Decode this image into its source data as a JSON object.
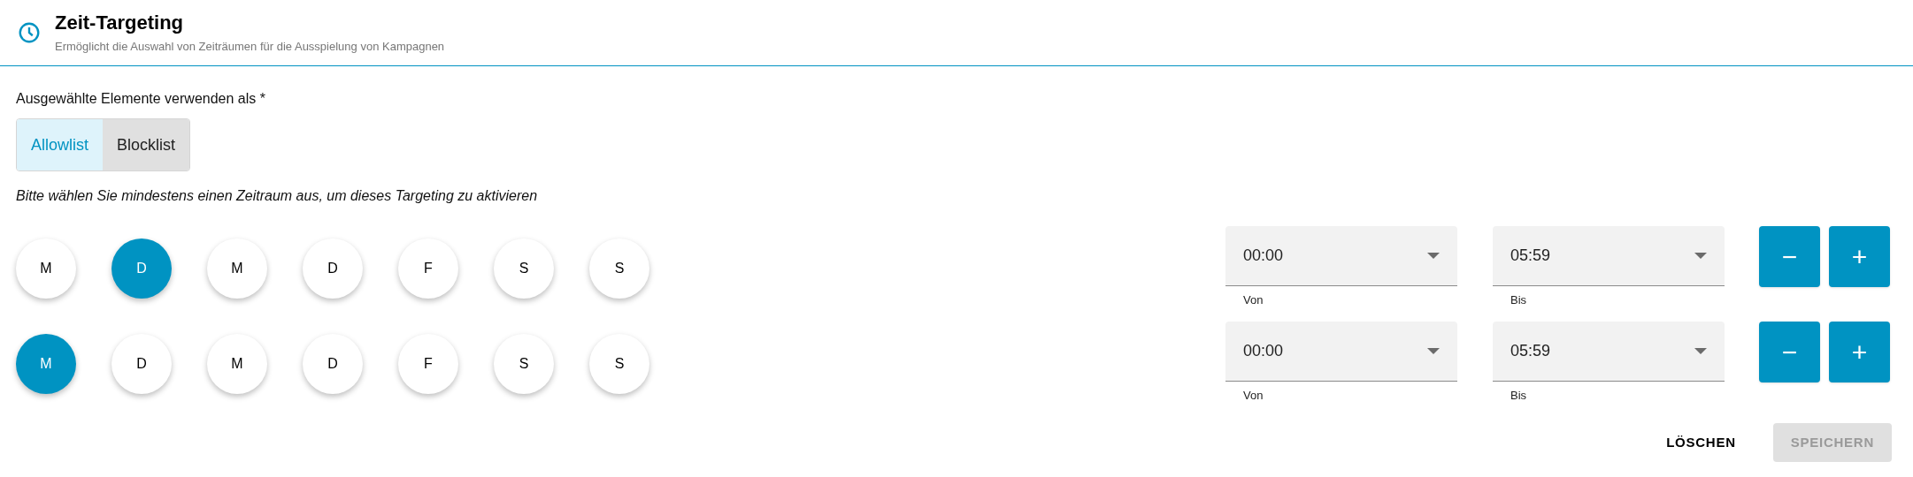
{
  "header": {
    "title": "Zeit-Targeting",
    "subtitle": "Ermöglicht die Auswahl von Zeiträumen für die Ausspielung von Kampagnen"
  },
  "mode": {
    "label": "Ausgewählte Elemente verwenden als *",
    "options": [
      {
        "label": "Allowlist",
        "selected": true
      },
      {
        "label": "Blocklist",
        "selected": false
      }
    ]
  },
  "hint": "Bitte wählen Sie mindestens einen Zeitraum aus, um dieses Targeting zu aktivieren",
  "periods": [
    {
      "days": [
        {
          "label": "M",
          "selected": false
        },
        {
          "label": "D",
          "selected": true
        },
        {
          "label": "M",
          "selected": false
        },
        {
          "label": "D",
          "selected": false
        },
        {
          "label": "F",
          "selected": false
        },
        {
          "label": "S",
          "selected": false
        },
        {
          "label": "S",
          "selected": false
        }
      ],
      "from": {
        "value": "00:00",
        "label": "Von"
      },
      "to": {
        "value": "05:59",
        "label": "Bis"
      },
      "remove": "−",
      "add": "+"
    },
    {
      "days": [
        {
          "label": "M",
          "selected": true
        },
        {
          "label": "D",
          "selected": false
        },
        {
          "label": "M",
          "selected": false
        },
        {
          "label": "D",
          "selected": false
        },
        {
          "label": "F",
          "selected": false
        },
        {
          "label": "S",
          "selected": false
        },
        {
          "label": "S",
          "selected": false
        }
      ],
      "from": {
        "value": "00:00",
        "label": "Von"
      },
      "to": {
        "value": "05:59",
        "label": "Bis"
      },
      "remove": "−",
      "add": "+"
    }
  ],
  "actions": [
    {
      "label": "LÖSCHEN",
      "disabled": false
    },
    {
      "label": "SPEICHERN",
      "disabled": true
    }
  ]
}
